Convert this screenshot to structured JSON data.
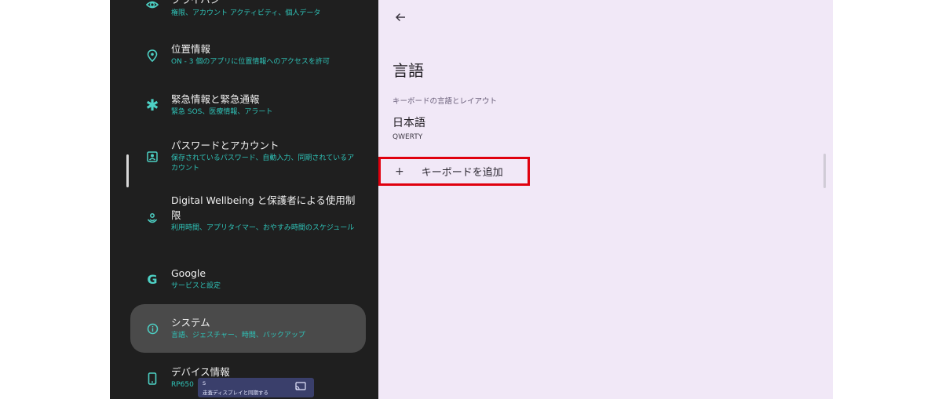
{
  "sidebar": {
    "items": [
      {
        "title": "プライバシー",
        "subtitle": "権限、アカウント アクティビティ、個人データ",
        "icon": "privacy-eye-icon"
      },
      {
        "title": "位置情報",
        "subtitle": "ON - 3 個のアプリに位置情報へのアクセスを許可",
        "icon": "location-pin-icon"
      },
      {
        "title": "緊急情報と緊急通報",
        "subtitle": "緊急 SOS、医療情報、アラート",
        "icon": "asterisk-icon"
      },
      {
        "title": "パスワードとアカウント",
        "subtitle": "保存されているパスワード、自動入力、同期されているアカウント",
        "icon": "account-box-icon"
      },
      {
        "title": "Digital Wellbeing と保護者による使用制限",
        "subtitle": "利用時間、アプリタイマー、おやすみ時間のスケジュール",
        "icon": "wellbeing-icon"
      },
      {
        "title": "Google",
        "subtitle": "サービスと設定",
        "icon": "google-g-icon"
      },
      {
        "title": "システム",
        "subtitle": "言語、ジェスチャー、時間、バックアップ",
        "icon": "info-circle-icon"
      },
      {
        "title": "デバイス情報",
        "subtitle": "RP650",
        "icon": "phone-icon"
      }
    ]
  },
  "cast_chip": {
    "line1": "S",
    "line2": "走査ディスプレイと同期する",
    "icon": "cast-icon"
  },
  "content": {
    "title": "言語",
    "section_header": "キーボードの言語とレイアウト",
    "language": {
      "name": "日本語",
      "layout": "QWERTY"
    },
    "add_keyboard": {
      "plus": "+",
      "label": "キーボードを追加"
    }
  },
  "colors": {
    "sidebar_bg": "#1f1f1f",
    "accent_teal": "#2fc3b8",
    "content_bg": "#f1e8f7",
    "highlight_red": "#e0000e",
    "selected_bg": "#4a4a4a"
  }
}
